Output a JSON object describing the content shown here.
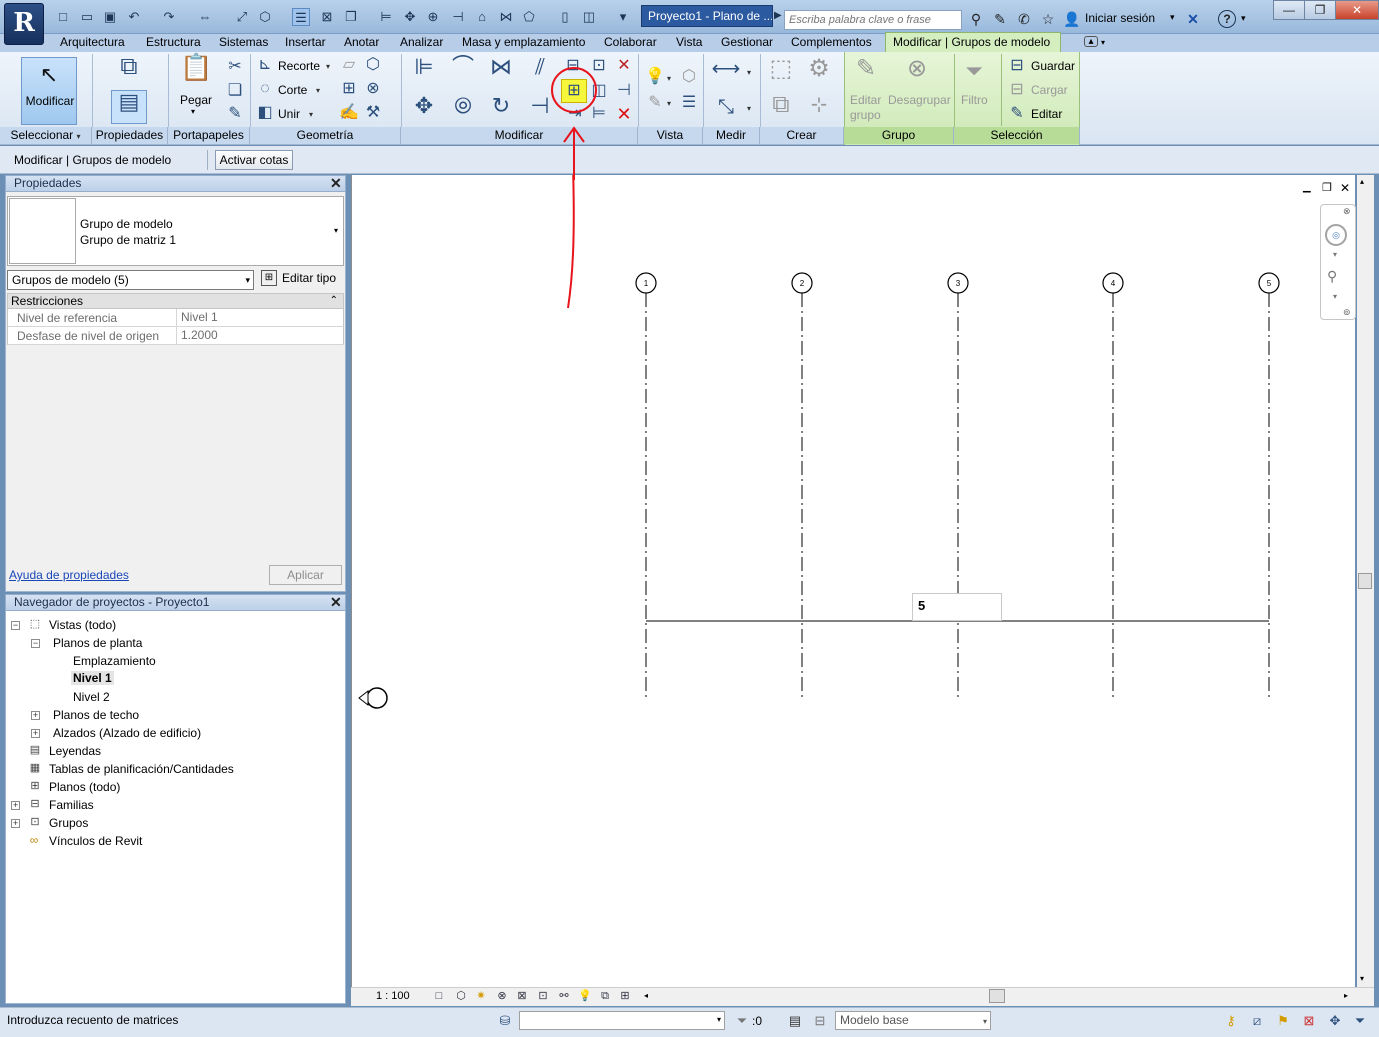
{
  "titlebar": {
    "app_logo": "R",
    "doc_title": "Proyecto1 - Plano de ...",
    "search_placeholder": "Escriba palabra clave o frase",
    "signin_label": "Iniciar sesión"
  },
  "tabs": [
    "Arquitectura",
    "Estructura",
    "Sistemas",
    "Insertar",
    "Anotar",
    "Analizar",
    "Masa y emplazamiento",
    "Colaborar",
    "Vista",
    "Gestionar",
    "Complementos"
  ],
  "active_tab": "Modificar | Grupos de modelo",
  "ribbon": {
    "modificar_label": "Modificar",
    "pegar_label": "Pegar",
    "recorte_label": "Recorte",
    "corte_label": "Corte",
    "unir_label": "Unir",
    "editar_grupo_label": "Editar grupo",
    "editar_grupo_line1": "Editar",
    "editar_grupo_line2": "grupo",
    "desagrupar_label": "Desagrupar",
    "filtro_label": "Filtro",
    "guardar_label": "Guardar",
    "cargar_label": "Cargar",
    "editar_label": "Editar",
    "panels": {
      "seleccionar": "Seleccionar",
      "propiedades": "Propiedades",
      "portapapeles": "Portapapeles",
      "geometria": "Geometría",
      "modificar": "Modificar",
      "vista": "Vista",
      "medir": "Medir",
      "crear": "Crear",
      "grupo": "Grupo",
      "seleccion": "Selección"
    }
  },
  "optionsbar": {
    "context_label": "Modificar | Grupos de modelo",
    "activar_cotas": "Activar cotas"
  },
  "properties": {
    "title": "Propiedades",
    "type_family": "Grupo de modelo",
    "type_name": "Grupo de matriz 1",
    "instance_selector": "Grupos de modelo (5)",
    "edit_type_label": "Editar tipo",
    "section": "Restricciones",
    "rows": [
      {
        "name": "Nivel de referencia",
        "value": "Nivel 1"
      },
      {
        "name": "Desfase de nivel de origen",
        "value": "1.2000"
      }
    ],
    "help_link": "Ayuda de propiedades",
    "apply_label": "Aplicar"
  },
  "browser": {
    "title": "Navegador de proyectos - Proyecto1",
    "items": {
      "vistas": "Vistas (todo)",
      "planos_planta": "Planos de planta",
      "emplazamiento": "Emplazamiento",
      "nivel1": "Nivel 1",
      "nivel2": "Nivel 2",
      "planos_techo": "Planos de techo",
      "alzados": "Alzados (Alzado de edificio)",
      "leyendas": "Leyendas",
      "tablas": "Tablas de planificación/Cantidades",
      "planos": "Planos (todo)",
      "familias": "Familias",
      "grupos": "Grupos",
      "vinculos": "Vínculos de Revit"
    }
  },
  "canvas": {
    "grid_labels": [
      "1",
      "2",
      "3",
      "4",
      "5"
    ],
    "array_count": "5",
    "scale": "1 : 100"
  },
  "statusbar": {
    "text": "Introduzca recuento de matrices",
    "selection_count": ":0",
    "model_label": "Modelo base"
  },
  "colors": {
    "highlight": "#f6f63a",
    "annotation": "#e8141c",
    "context_tab": "#d4eec0"
  }
}
